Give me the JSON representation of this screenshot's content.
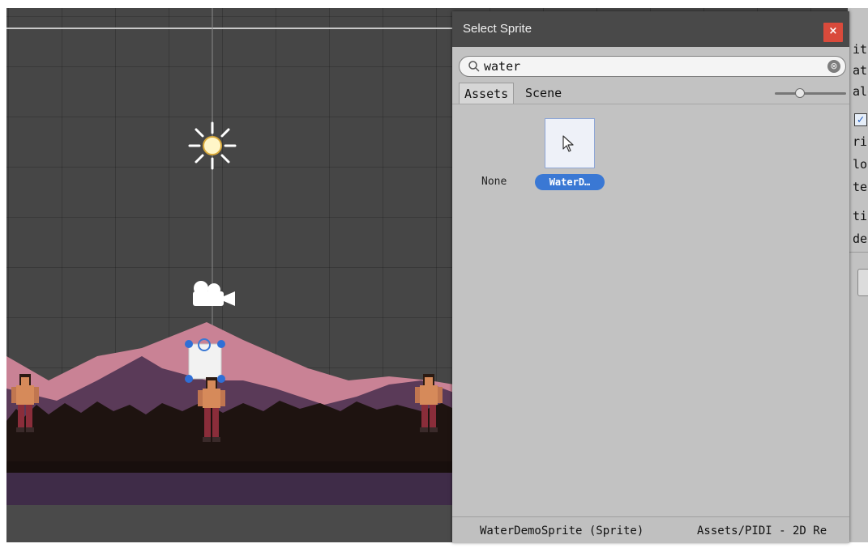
{
  "dialog": {
    "title": "Select Sprite",
    "close_label": "×",
    "search": {
      "value": "water",
      "clear_label": "⊗"
    },
    "tabs": [
      {
        "label": "Assets",
        "active": true
      },
      {
        "label": "Scene",
        "active": false
      }
    ],
    "zoom_level": 0.33,
    "items": [
      {
        "label": "None"
      },
      {
        "label": "WaterD…",
        "selected": true
      }
    ],
    "status": {
      "name": "WaterDemoSprite (Sprite)",
      "path": "Assets/PIDI - 2D Re"
    }
  },
  "inspector": {
    "fragments": [
      "iti",
      "ati",
      "ale",
      "rite",
      "lor",
      "ter",
      "tir",
      "der"
    ],
    "checkbox_checked": true
  },
  "scene": {
    "icons": [
      "sun-icon",
      "camera-icon",
      "selected-sprite-gizmo"
    ],
    "colors": {
      "sky": "#464646",
      "mountain_far": "#c98295",
      "mountain_near": "#5a3a58",
      "forest": "#1e1310",
      "ground": "#3f2c48"
    }
  },
  "colors": {
    "accent": "#3a78d4",
    "close": "#d94a3b",
    "dialog_bg": "#c2c2c2",
    "titlebar": "#494949"
  }
}
